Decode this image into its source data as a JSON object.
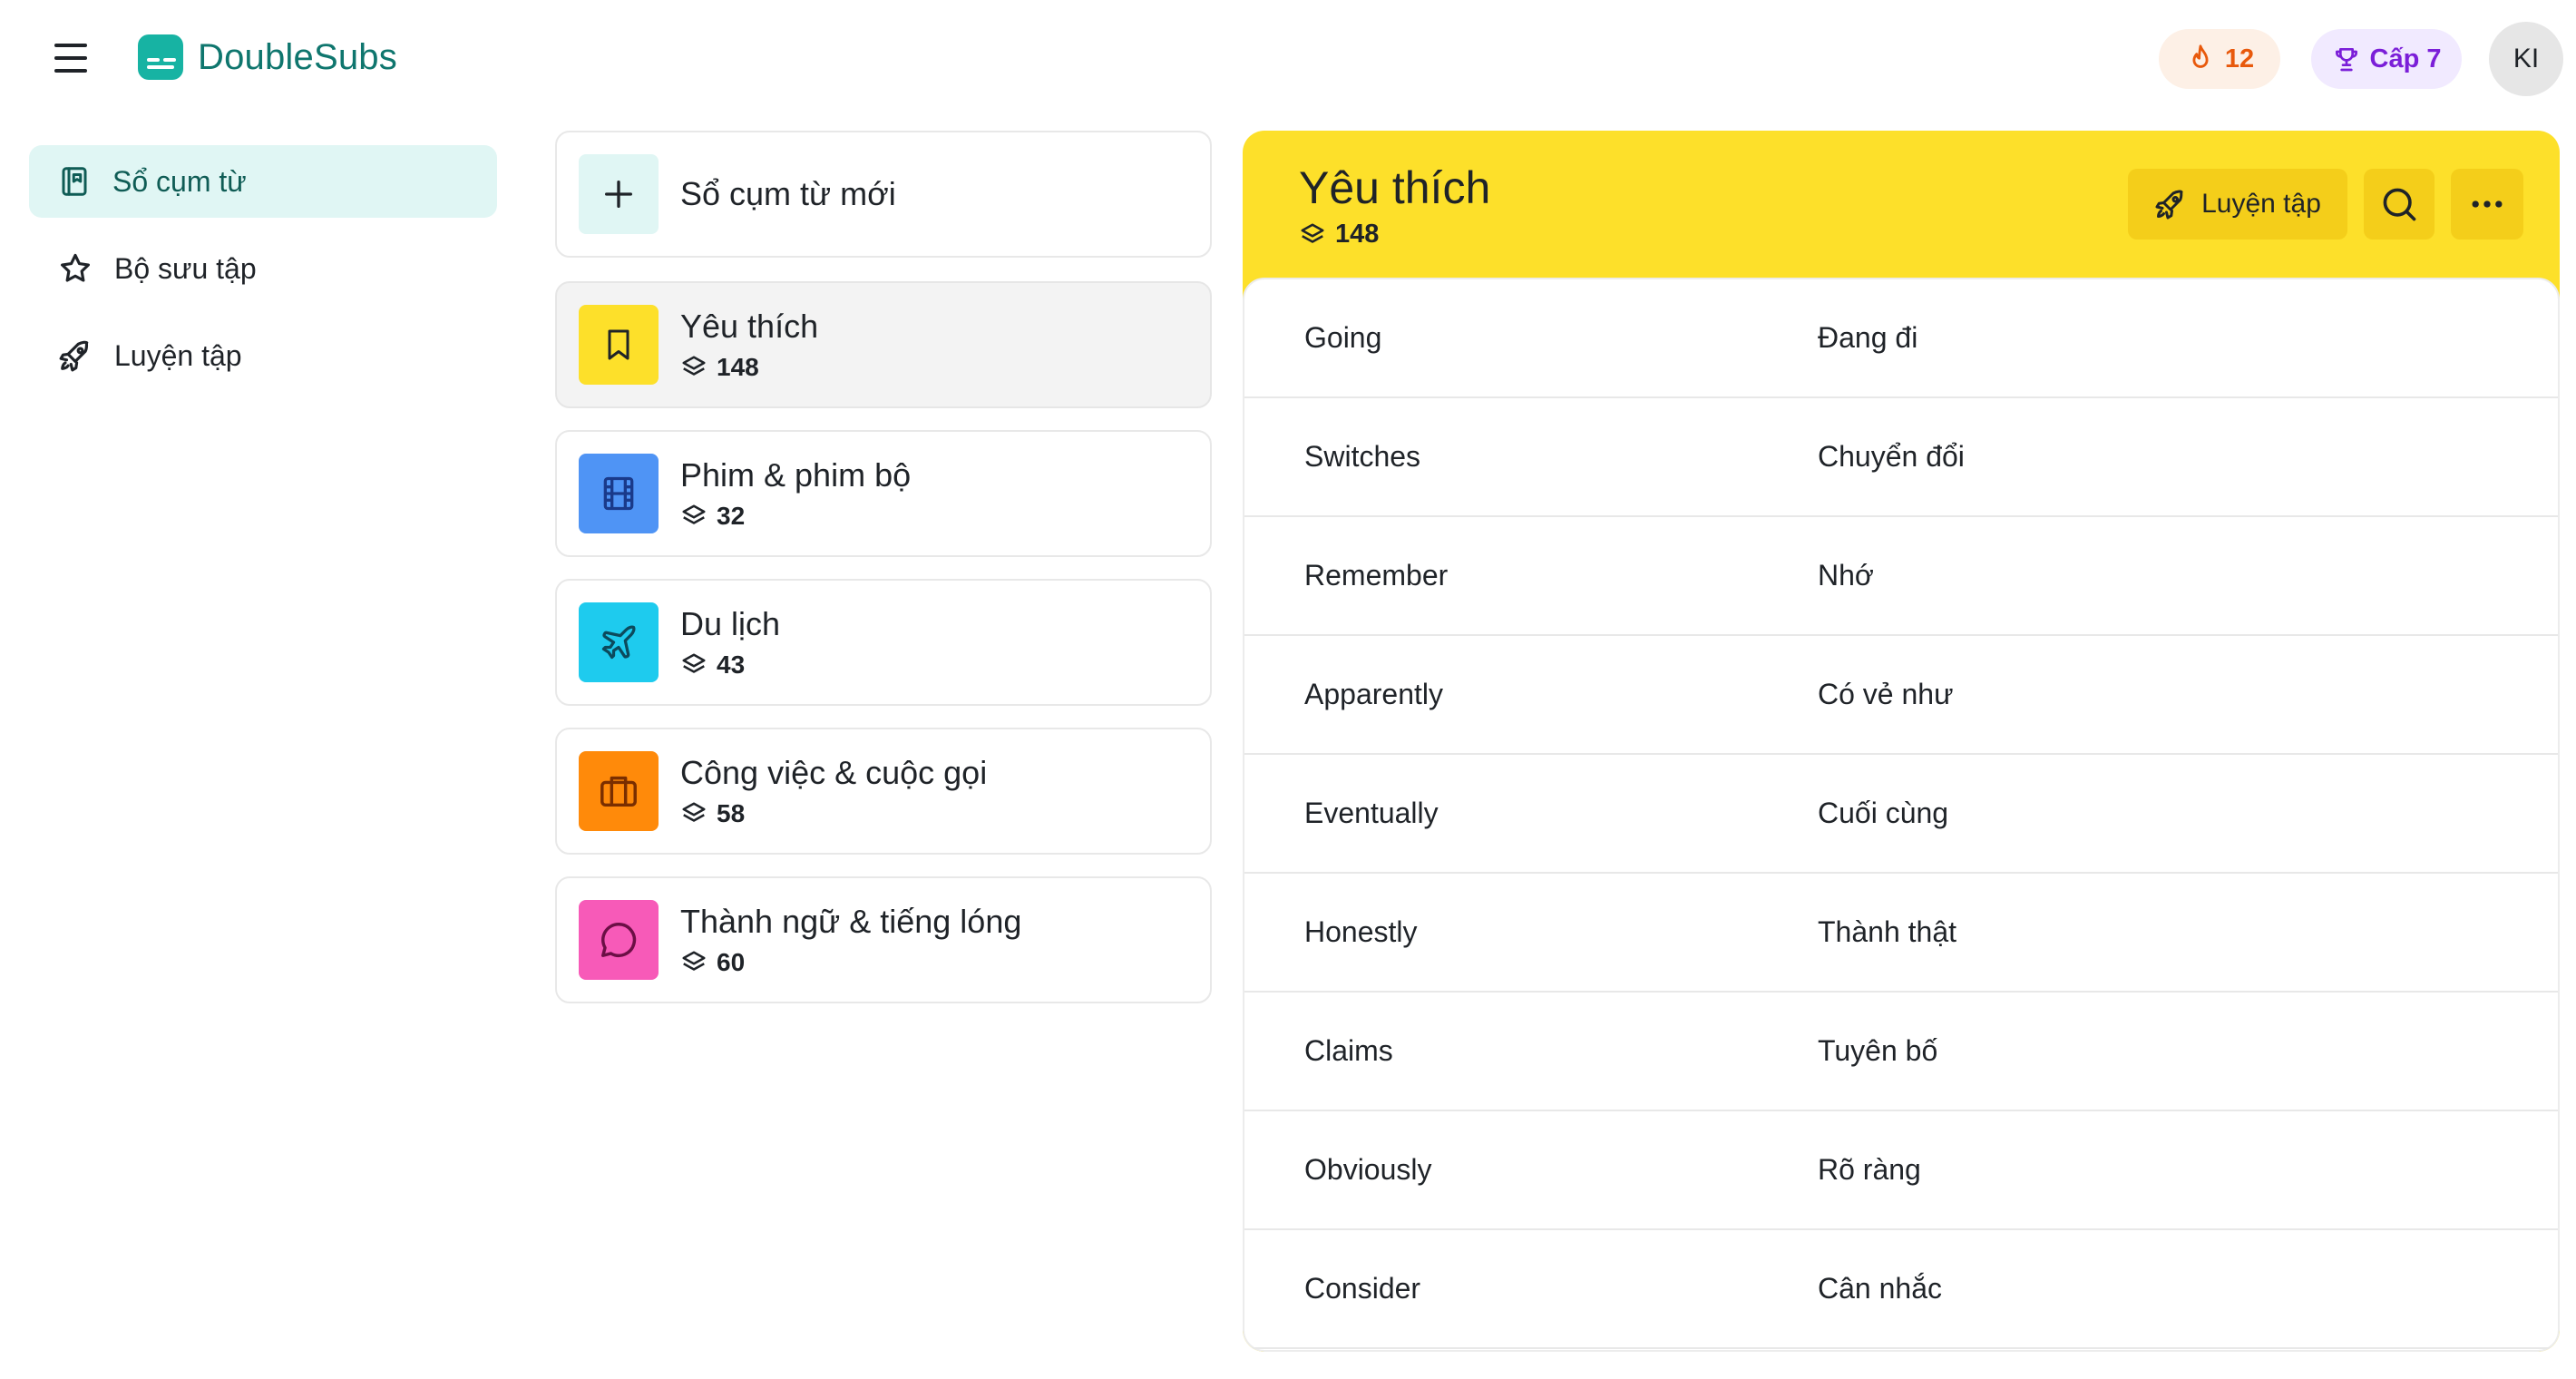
{
  "header": {
    "menu_icon": "hamburger-icon",
    "logo_icon": "subtitles-icon",
    "app_name": "DoubleSubs",
    "streak_icon": "flame-icon",
    "streak": "12",
    "level_icon": "trophy-icon",
    "level": "Cấp 7",
    "avatar_initials": "KI",
    "colors": {
      "brand": "#17b3a3",
      "streak": "#e8590c",
      "level": "#7b1fd8"
    }
  },
  "sidebar": {
    "items": [
      {
        "label": "Sổ cụm từ",
        "icon": "notebook-icon",
        "active": true
      },
      {
        "label": "Bộ sưu tập",
        "icon": "star-icon",
        "active": false
      },
      {
        "label": "Luyện tập",
        "icon": "rocket-icon",
        "active": false
      }
    ]
  },
  "phrasebooks": {
    "new_label": "Sổ cụm từ mới",
    "new_icon": "plus-icon",
    "items": [
      {
        "title": "Yêu thích",
        "count": "148",
        "icon": "bookmark-icon",
        "color": "#fde02a",
        "selected": true
      },
      {
        "title": "Phim & phim bộ",
        "count": "32",
        "icon": "film-icon",
        "color": "#4f94f5",
        "selected": false
      },
      {
        "title": "Du lịch",
        "count": "43",
        "icon": "plane-icon",
        "color": "#1ecbee",
        "selected": false
      },
      {
        "title": "Công việc & cuộc gọi",
        "count": "58",
        "icon": "briefcase-icon",
        "color": "#ff8a0a",
        "selected": false
      },
      {
        "title": "Thành ngữ & tiếng lóng",
        "count": "60",
        "icon": "chat-bubble-icon",
        "color": "#f75ab8",
        "selected": false
      }
    ]
  },
  "detail": {
    "title": "Yêu thích",
    "count": "148",
    "practice_label": "Luyện tập",
    "search_icon": "search-icon",
    "more_icon": "more-horizontal-icon",
    "accent": "#fde02a",
    "rows": [
      {
        "term": "Going",
        "meaning": "Đang đi"
      },
      {
        "term": "Switches",
        "meaning": "Chuyển đổi"
      },
      {
        "term": "Remember",
        "meaning": "Nhớ"
      },
      {
        "term": "Apparently",
        "meaning": "Có vẻ như"
      },
      {
        "term": "Eventually",
        "meaning": "Cuối cùng"
      },
      {
        "term": "Honestly",
        "meaning": "Thành thật"
      },
      {
        "term": "Claims",
        "meaning": "Tuyên bố"
      },
      {
        "term": "Obviously",
        "meaning": "Rõ ràng"
      },
      {
        "term": "Consider",
        "meaning": "Cân nhắc"
      }
    ]
  }
}
